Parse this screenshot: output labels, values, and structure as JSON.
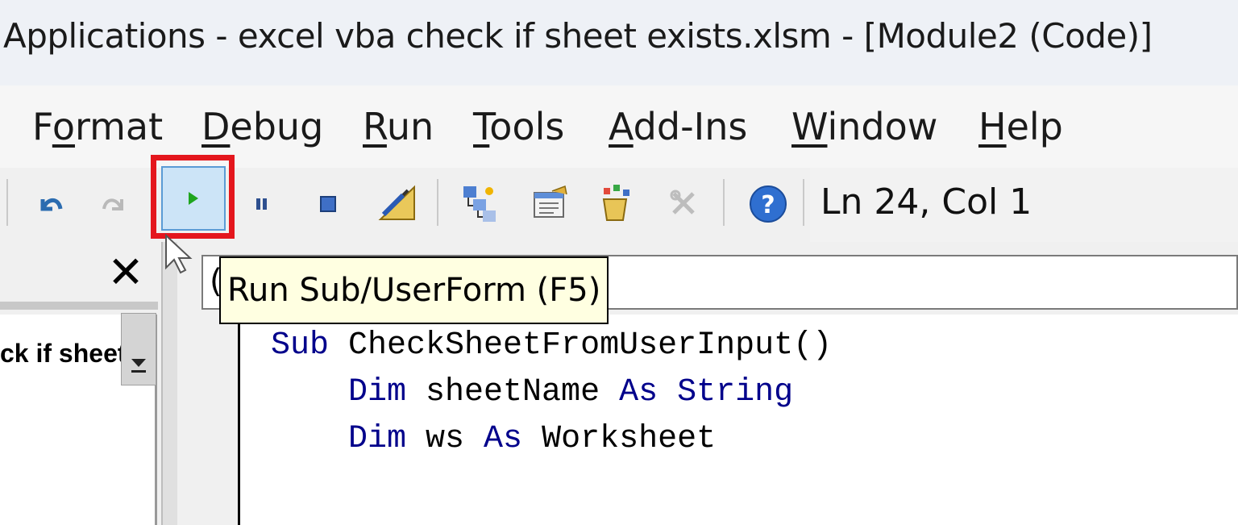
{
  "window": {
    "title": "Applications - excel vba check if sheet exists.xlsm - [Module2 (Code)]"
  },
  "menu": {
    "items": [
      {
        "pre": "F",
        "u": "o",
        "post": "rmat"
      },
      {
        "pre": "",
        "u": "D",
        "post": "ebug"
      },
      {
        "pre": "",
        "u": "R",
        "post": "un"
      },
      {
        "pre": "",
        "u": "T",
        "post": "ools"
      },
      {
        "pre": "",
        "u": "A",
        "post": "dd-Ins"
      },
      {
        "pre": "",
        "u": "W",
        "post": "indow"
      },
      {
        "pre": "",
        "u": "H",
        "post": "elp"
      }
    ]
  },
  "toolbar": {
    "status": "Ln 24, Col 1",
    "icons": [
      "undo-icon",
      "redo-icon",
      "run-icon",
      "break-icon",
      "reset-icon",
      "design-mode-icon",
      "project-explorer-icon",
      "properties-icon",
      "object-browser-icon",
      "toolbox-icon",
      "help-icon"
    ]
  },
  "tooltip": {
    "text": "Run Sub/UserForm (F5)"
  },
  "project_pane": {
    "close_glyph": "✕",
    "tree_text": "ck if sheet"
  },
  "code": {
    "header_glyph": "(",
    "lines": [
      {
        "indent": "",
        "parts": [
          {
            "t": "Sub ",
            "kw": true
          },
          {
            "t": "CheckSheetFromUserInput()",
            "kw": false
          }
        ]
      },
      {
        "indent": "    ",
        "parts": [
          {
            "t": "Dim ",
            "kw": true
          },
          {
            "t": "sheetName ",
            "kw": false
          },
          {
            "t": "As ",
            "kw": true
          },
          {
            "t": "String",
            "kw": true
          }
        ]
      },
      {
        "indent": "    ",
        "parts": [
          {
            "t": "Dim ",
            "kw": true
          },
          {
            "t": "ws ",
            "kw": false
          },
          {
            "t": "As ",
            "kw": true
          },
          {
            "t": "Worksheet",
            "kw": false
          }
        ]
      }
    ]
  },
  "colors": {
    "highlight": "#e4161d",
    "keyword": "#00008b",
    "tooltip_bg": "#ffffe1"
  }
}
